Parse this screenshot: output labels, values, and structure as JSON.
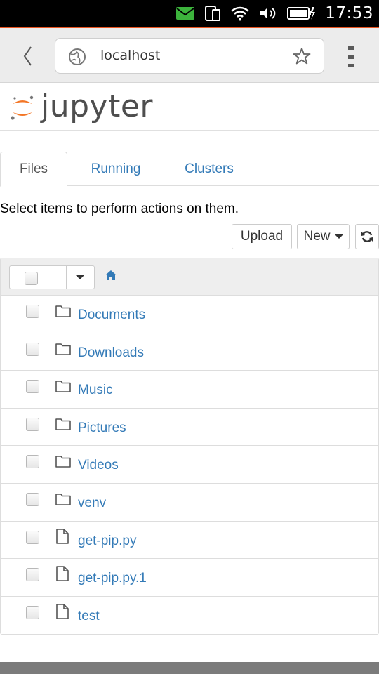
{
  "status_bar": {
    "time": "17:53",
    "icons": [
      "mail-icon",
      "phone-tablet-icon",
      "wifi-icon",
      "volume-icon",
      "battery-charging-icon"
    ],
    "mail_color": "#3cb33c",
    "accent_line_color": "#e95420"
  },
  "browser": {
    "url": "localhost",
    "icons": [
      "back-chevron-icon",
      "globe-icon",
      "bookmark-star-icon",
      "overflow-menu-icon"
    ]
  },
  "app": {
    "logo_text": "jupyter",
    "logo_color": "#f37626"
  },
  "tabs": [
    {
      "label": "Files",
      "active": true
    },
    {
      "label": "Running",
      "active": false
    },
    {
      "label": "Clusters",
      "active": false
    }
  ],
  "hint_text": "Select items to perform actions on them.",
  "toolbar": {
    "upload_label": "Upload",
    "new_label": "New",
    "refresh_icon": "refresh-icon"
  },
  "files": [
    {
      "name": "Documents",
      "type": "folder"
    },
    {
      "name": "Downloads",
      "type": "folder"
    },
    {
      "name": "Music",
      "type": "folder"
    },
    {
      "name": "Pictures",
      "type": "folder"
    },
    {
      "name": "Videos",
      "type": "folder"
    },
    {
      "name": "venv",
      "type": "folder"
    },
    {
      "name": "get-pip.py",
      "type": "file"
    },
    {
      "name": "get-pip.py.1",
      "type": "file"
    },
    {
      "name": "test",
      "type": "file"
    }
  ],
  "link_color": "#337ab7"
}
